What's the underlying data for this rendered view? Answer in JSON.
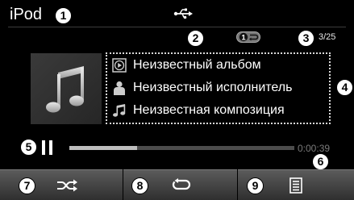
{
  "header": {
    "title": "iPod",
    "connection_icon": "usb-icon"
  },
  "callouts": [
    "1",
    "2",
    "3",
    "4",
    "5",
    "6",
    "7",
    "8",
    "9"
  ],
  "status": {
    "repeat_indicator_text": "1",
    "track_counter": "3/25"
  },
  "track_info": {
    "album": "Неизвестный альбом",
    "artist": "Неизвестный исполнитель",
    "title": "Неизвестная композиция"
  },
  "playback": {
    "state": "paused",
    "progress": 0.3,
    "elapsed": "0:00:39"
  },
  "bottom_bar": [
    {
      "icon": "shuffle-icon"
    },
    {
      "icon": "repeat-icon"
    },
    {
      "icon": "list-icon"
    }
  ],
  "colors": {
    "background": "#000000",
    "text": "#ffffff",
    "muted_text": "#7a7a7a",
    "progress_fill": "#bdbdbd"
  }
}
